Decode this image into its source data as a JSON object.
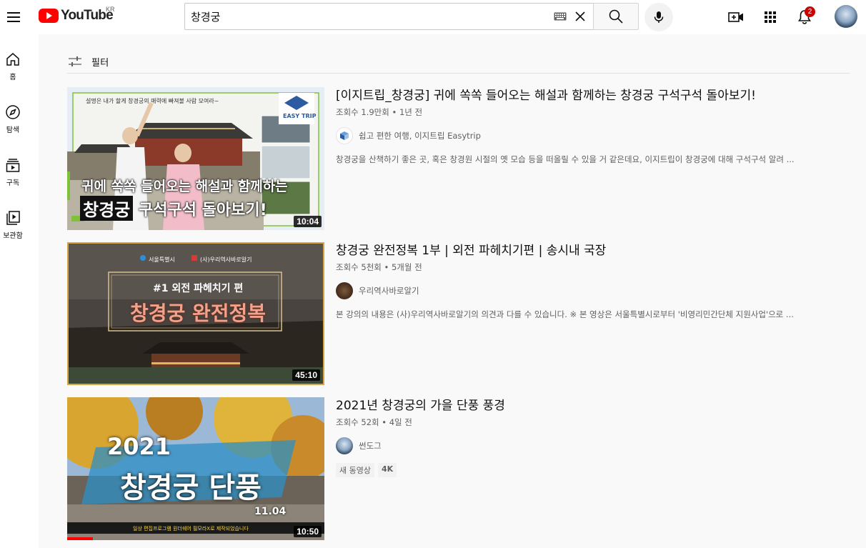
{
  "header": {
    "logo_text": "YouTube",
    "region": "KR",
    "search_value": "창경궁",
    "notification_count": "2"
  },
  "guide": {
    "items": [
      {
        "label": "홈",
        "icon": "home-icon"
      },
      {
        "label": "탐색",
        "icon": "compass-icon"
      },
      {
        "label": "구독",
        "icon": "subscriptions-icon"
      },
      {
        "label": "보관함",
        "icon": "library-icon"
      }
    ]
  },
  "filter": {
    "label": "필터"
  },
  "results": [
    {
      "title": "[이지트립_창경궁] 귀에 쏙쏙 들어오는 해설과 함께하는 창경궁 구석구석 돌아보기!",
      "meta": "조회수 1.9만회 • 1년 전",
      "channel": "쉽고 편한 여행, 이지트립 Easytrip",
      "description": "창경궁을 산책하기 좋은 곳, 혹은 창경원 시절의 옛 모습 등을 떠올릴 수 있을 거 같은데요, 이지트립이 창경궁에 대해 구석구석 알려 ...",
      "duration": "10:04",
      "thumb_caption_top": "설명은 내가 할게 창경궁의 매력에 빠져볼 사람 모여라~",
      "thumb_caption_1": "귀에 쏙쏙 들어오는 해설과 함께하는",
      "thumb_caption_2a": "창경궁",
      "thumb_caption_2b": "구석구석 돌아보기!",
      "thumb_logo": "EASY TRIP"
    },
    {
      "title": "창경궁 완전정복 1부 | 외전 파헤치기편 | 송시내 국장",
      "meta": "조회수 5천회 • 5개월 전",
      "channel": "우리역사바로알기",
      "description": "본 강의의 내용은 (사)우리역사바로알기의 의견과 다를 수 있습니다. ※ 본 영상은 서울특별시로부터 '비영리민간단체 지원사업'으로 ...",
      "duration": "45:10",
      "thumb_org_1": "서울특별시",
      "thumb_org_2": "(사)우리역사바로알기",
      "thumb_caption_1": "#1 외전 파헤치기 편",
      "thumb_caption_2": "창경궁 완전정복"
    },
    {
      "title": "2021년 창경궁의 가을 단풍 풍경",
      "meta": "조회수 52회 • 4일 전",
      "channel": "썬도그",
      "duration": "10:50",
      "badges": [
        "새 동영상",
        "4K"
      ],
      "thumb_caption_1": "2021",
      "thumb_caption_2": "창경궁 단풍",
      "thumb_date": "11.04",
      "thumb_footer": "일상 편집프로그램 원더쉐어 필모라X로 제작되었습니다"
    }
  ],
  "colors": {
    "brand_red": "#ff0000",
    "badge_red": "#cc0000",
    "text_primary": "#0f0f0f",
    "text_secondary": "#606060"
  }
}
